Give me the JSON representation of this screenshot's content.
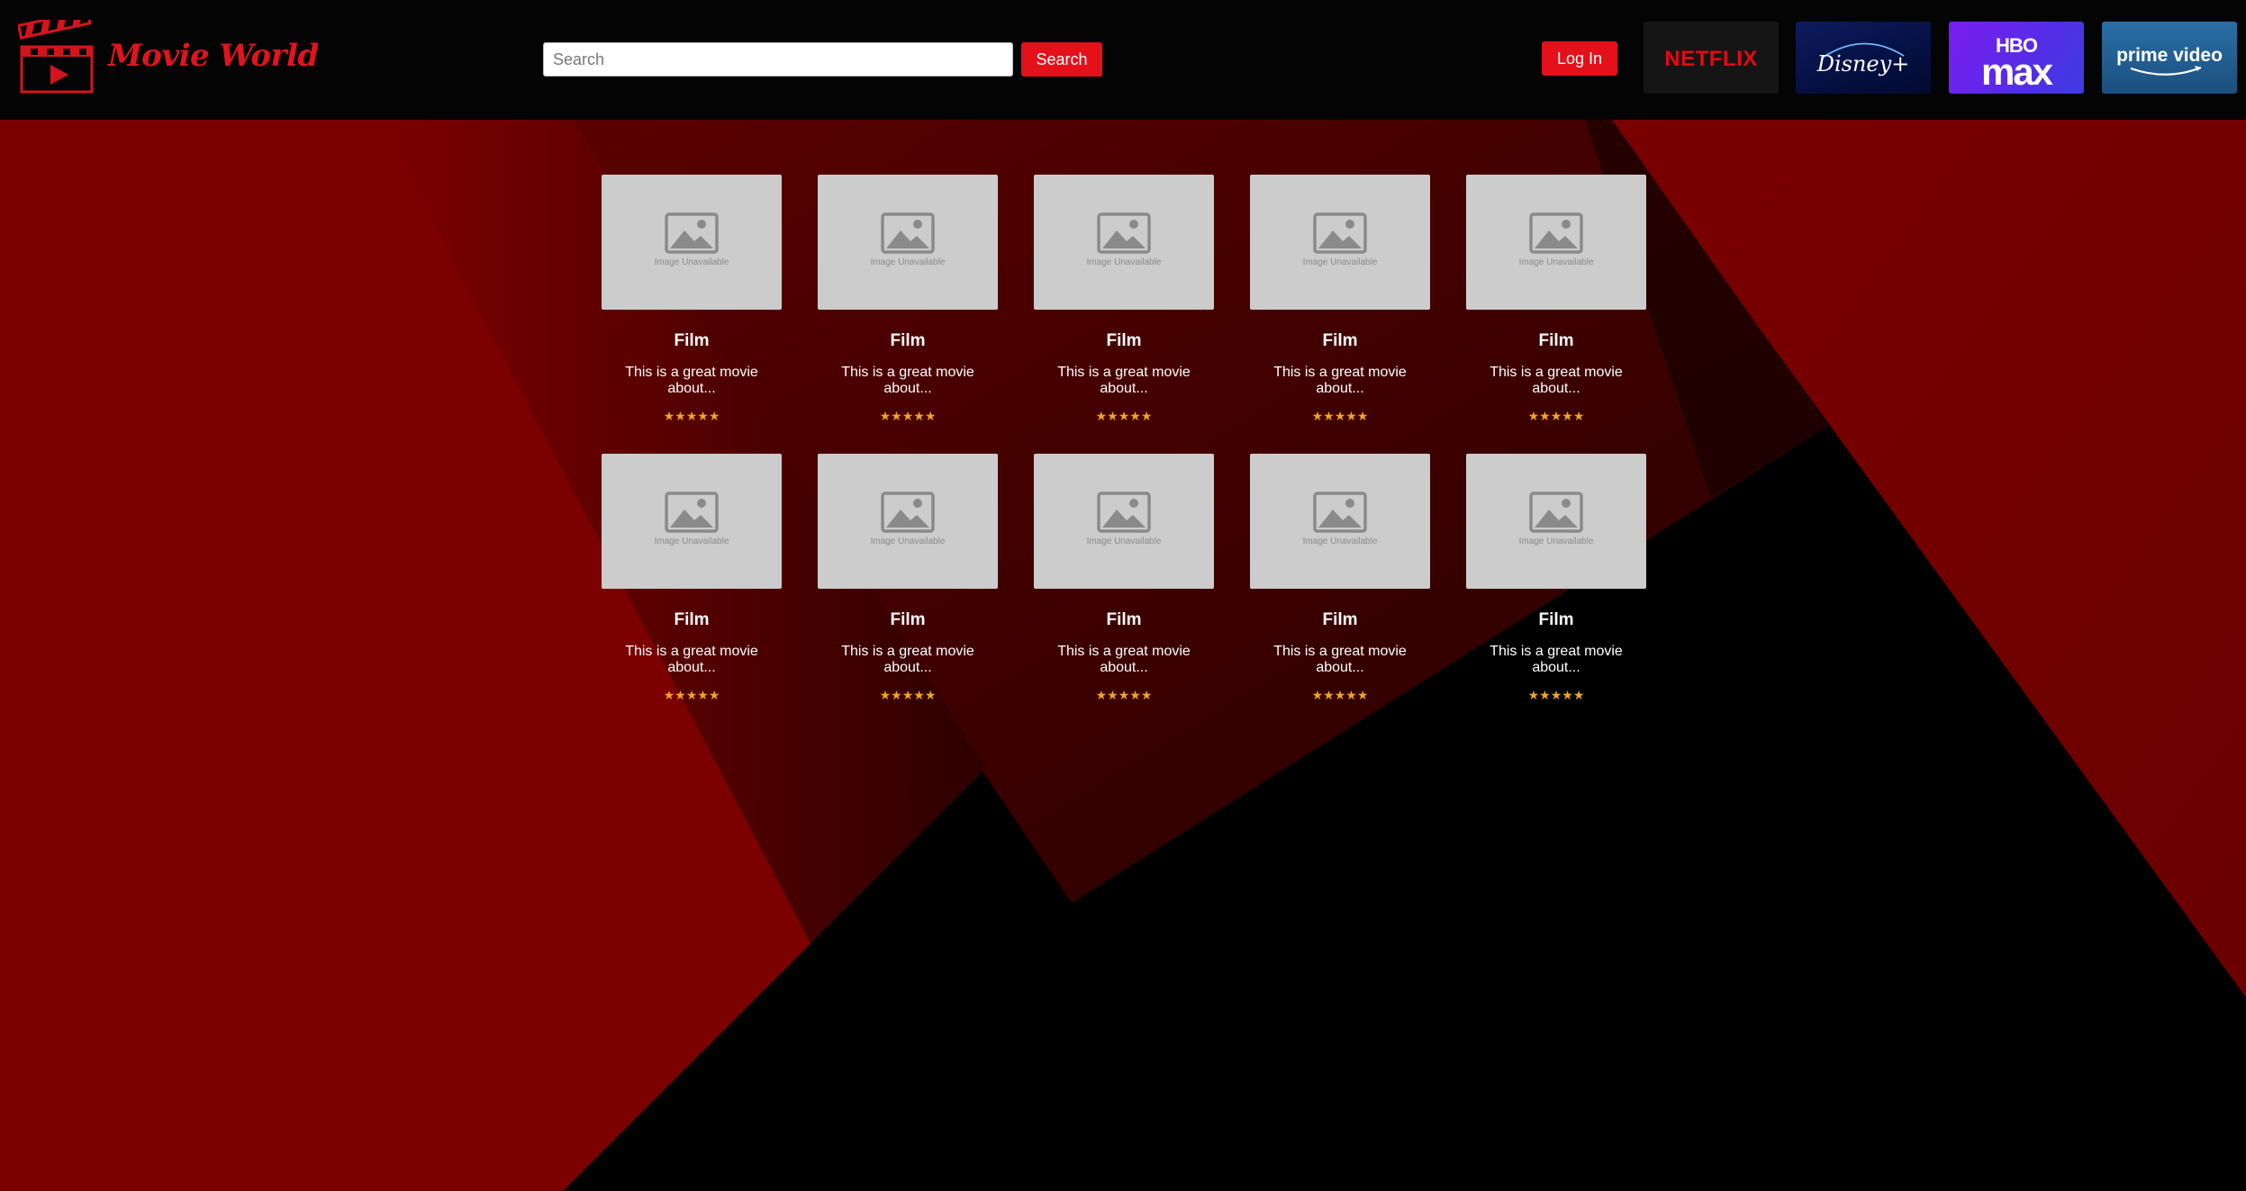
{
  "header": {
    "brand": "Movie World",
    "search_placeholder": "Search",
    "search_button": "Search",
    "login_button": "Log In"
  },
  "services": [
    {
      "name": "Netflix",
      "label": "NETFLIX"
    },
    {
      "name": "Disney+",
      "label": "Disney+"
    },
    {
      "name": "HBO Max",
      "label_top": "HBO",
      "label_bottom": "max"
    },
    {
      "name": "Prime Video",
      "label": "prime video"
    }
  ],
  "movies": [
    {
      "image_caption": "Image Unavailable",
      "title": "Film",
      "description": "This is a great movie about...",
      "stars": "★★★★★",
      "rating": 5
    },
    {
      "image_caption": "Image Unavailable",
      "title": "Film",
      "description": "This is a great movie about...",
      "stars": "★★★★★",
      "rating": 5
    },
    {
      "image_caption": "Image Unavailable",
      "title": "Film",
      "description": "This is a great movie about...",
      "stars": "★★★★★",
      "rating": 5
    },
    {
      "image_caption": "Image Unavailable",
      "title": "Film",
      "description": "This is a great movie about...",
      "stars": "★★★★★",
      "rating": 5
    },
    {
      "image_caption": "Image Unavailable",
      "title": "Film",
      "description": "This is a great movie about...",
      "stars": "★★★★★",
      "rating": 5
    },
    {
      "image_caption": "Image Unavailable",
      "title": "Film",
      "description": "This is a great movie about...",
      "stars": "★★★★★",
      "rating": 5
    },
    {
      "image_caption": "Image Unavailable",
      "title": "Film",
      "description": "This is a great movie about...",
      "stars": "★★★★★",
      "rating": 5
    },
    {
      "image_caption": "Image Unavailable",
      "title": "Film",
      "description": "This is a great movie about...",
      "stars": "★★★★★",
      "rating": 5
    },
    {
      "image_caption": "Image Unavailable",
      "title": "Film",
      "description": "This is a great movie about...",
      "stars": "★★★★★",
      "rating": 5
    },
    {
      "image_caption": "Image Unavailable",
      "title": "Film",
      "description": "This is a great movie about...",
      "stars": "★★★★★",
      "rating": 5
    }
  ],
  "colors": {
    "accent": "#e4111a",
    "brand_text": "#e0141e",
    "header_bg": "#040404",
    "bg_red": "#7d0000",
    "bg_black": "#000000",
    "star": "#f0a424",
    "thumb_bg": "#cccccc"
  },
  "icons": {
    "logo": "clapperboard-play-icon",
    "placeholder": "image-placeholder-icon"
  }
}
